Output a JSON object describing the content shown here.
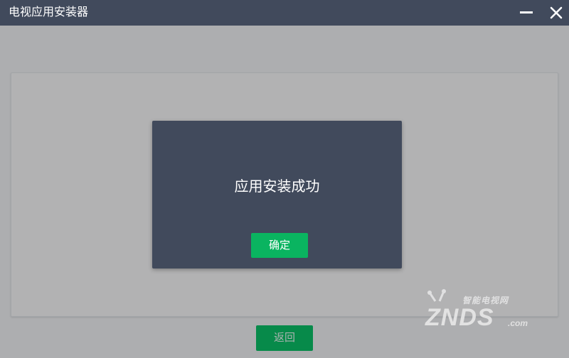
{
  "window": {
    "title": "电视应用安装器",
    "controls": {
      "minimize_icon": "minimize-icon",
      "close_icon": "close-icon"
    }
  },
  "dialog": {
    "message": "应用安装成功",
    "confirm_label": "确定"
  },
  "footer": {
    "back_label": "返回"
  },
  "watermark": {
    "cn_text": "智能电视网",
    "brand": "ZNDS",
    "domain": ".com"
  },
  "colors": {
    "titlebar": "#414a5c",
    "background": "#adaeb0",
    "panel": "#b2b2b3",
    "dialog": "#414a5c",
    "confirm_button": "#0ab460",
    "back_button": "#078a4a"
  }
}
